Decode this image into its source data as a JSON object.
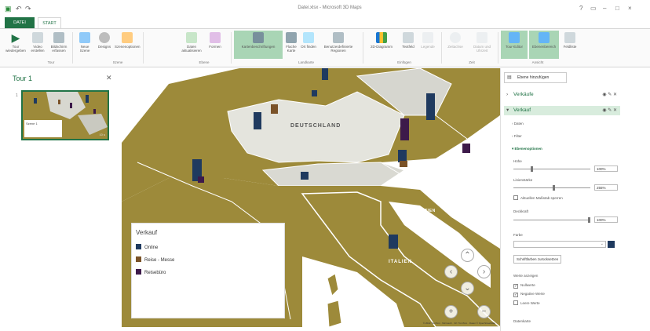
{
  "window": {
    "title": "Datei.xlsx - Microsoft 3D Maps"
  },
  "tabs": [
    {
      "label": "DATEI"
    },
    {
      "label": "START"
    }
  ],
  "ribbon": {
    "buttons": [
      {
        "label": "Tour wiedergeben",
        "icon": "play-icon"
      },
      {
        "label": "Video erstellen",
        "icon": "video-icon"
      },
      {
        "label": "Bildschirm erfassen",
        "icon": "camera-icon"
      },
      {
        "label": "Neue Szene",
        "icon": "new-scene-icon"
      },
      {
        "label": "Designs",
        "icon": "designs-icon"
      },
      {
        "label": "Szenenoptionen",
        "icon": "scene-options-icon"
      },
      {
        "label": "Daten aktualisieren",
        "icon": "refresh-icon"
      },
      {
        "label": "Formen",
        "icon": "shapes-icon"
      },
      {
        "label": "Kartenbeschriftungen",
        "icon": "map-labels-icon"
      },
      {
        "label": "Flache Karte",
        "icon": "flat-map-icon"
      },
      {
        "label": "Ort finden",
        "icon": "find-location-icon"
      },
      {
        "label": "Benutzerdefinierte Regionen",
        "icon": "custom-regions-icon"
      },
      {
        "label": "2D-Diagramm",
        "icon": "chart-icon"
      },
      {
        "label": "Textfeld",
        "icon": "textbox-icon"
      },
      {
        "label": "Legende",
        "icon": "legend-icon"
      },
      {
        "label": "Zeitachse",
        "icon": "timeline-icon"
      },
      {
        "label": "Datum und Uhrzeit",
        "icon": "datetime-icon"
      },
      {
        "label": "Tour-Editor",
        "icon": "tour-editor-icon"
      },
      {
        "label": "Ebenenbereich",
        "icon": "layer-pane-icon"
      },
      {
        "label": "Feldliste",
        "icon": "field-list-icon"
      }
    ],
    "groups": [
      "Tour",
      "Szene",
      "Ebene",
      "Landkarte",
      "Einfügen",
      "Zeit",
      "Ansicht"
    ]
  },
  "tour": {
    "title": "Tour 1",
    "scenes": [
      {
        "number": "1",
        "label": "Szene 1",
        "duration": "10 s"
      }
    ]
  },
  "map": {
    "labels": [
      "DEUTSCHLAND",
      "KROATIEN",
      "ITALIEN"
    ],
    "copyright": "© 2022 TomTom · Microsoft · Ort: TomTom · Daten © OpenStreetMap"
  },
  "legend": {
    "title": "Verkauf",
    "items": [
      {
        "label": "Online",
        "color": "#1f3a5f"
      },
      {
        "label": "Reise - Messe",
        "color": "#7a5228"
      },
      {
        "label": "Reisebüro",
        "color": "#3d1a4a"
      }
    ]
  },
  "layers": {
    "add_label": "Ebene hinzufügen",
    "items": [
      {
        "name": "Verkäufe"
      },
      {
        "name": "Verkauf"
      }
    ],
    "subsections": [
      "Daten",
      "Filter",
      "Ebenenoptionen"
    ],
    "options": {
      "height_label": "Höhe",
      "height_value": "100%",
      "thickness_label": "Linienstärke",
      "thickness_value": "255%",
      "scale_checkbox": "Aktuellen Maßstab sperren",
      "opacity_label": "Deckkraft",
      "opacity_value": "100%",
      "color_label": "Farbe",
      "color_button": "Schriftfarben zurücksetzen",
      "show_values_label": "Werte anzeigen",
      "checkboxes": [
        {
          "label": "Nullwerte",
          "checked": true
        },
        {
          "label": "Negative Werte",
          "checked": true
        },
        {
          "label": "Leere Werte",
          "checked": false
        }
      ],
      "datalabels_label": "Datenkarte"
    }
  },
  "colors": {
    "accent": "#217346",
    "land": "#9d8a3a"
  }
}
